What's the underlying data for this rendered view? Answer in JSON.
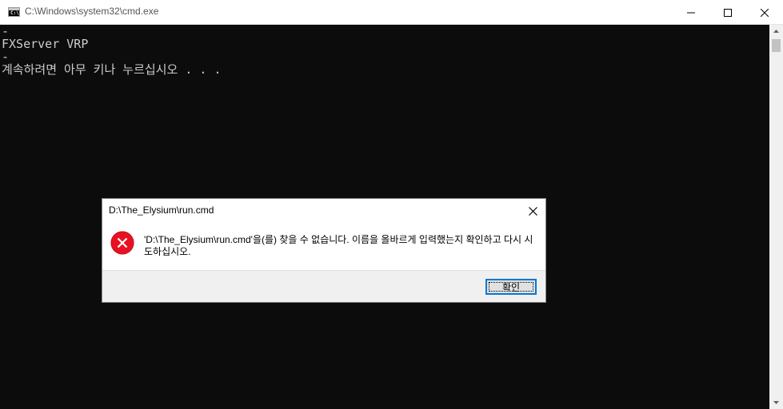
{
  "window": {
    "title": "C:\\Windows\\system32\\cmd.exe",
    "icon": "console-icon",
    "icon_text": "C:\\",
    "controls": [
      "minimize-icon",
      "maximize-icon",
      "close-icon"
    ]
  },
  "console": {
    "lines": [
      "-",
      "FXServer VRP",
      "-",
      "계속하려면 아무 키나 누르십시오 . . ."
    ],
    "text_color": "#cccccc",
    "background": "#0c0c0c"
  },
  "dialog": {
    "title": "D:\\The_Elysium\\run.cmd",
    "icon": "error-icon",
    "message": "'D:\\The_Elysium\\run.cmd'을(를) 찾을 수 없습니다. 이름을 올바르게 입력했는지 확인하고 다시 시도하십시오.",
    "ok_label": "확인",
    "accent_color": "#0078d7",
    "error_color": "#e81123"
  }
}
